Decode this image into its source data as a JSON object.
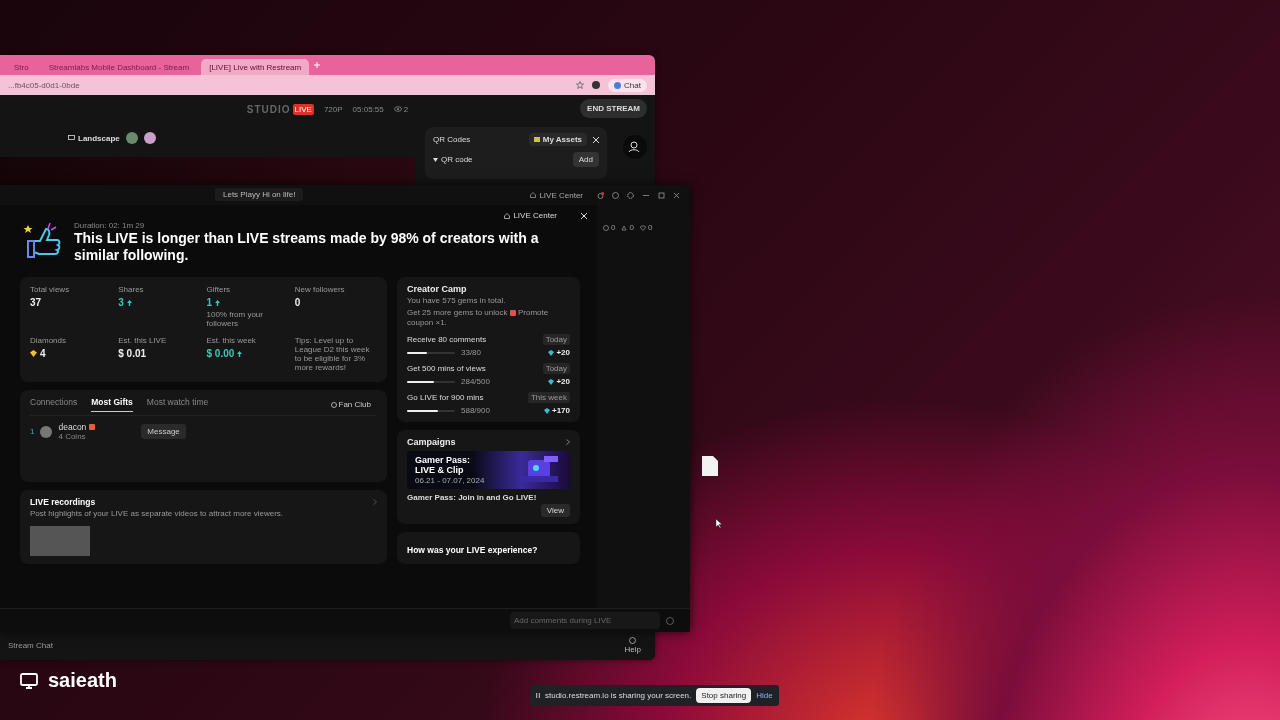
{
  "browser": {
    "tabs": [
      {
        "label": "Stro",
        "selected": false
      },
      {
        "label": "Streamlabs Mobile Dashboard - Stream",
        "selected": false
      },
      {
        "label": "[LIVE] Live with Restream",
        "selected": true
      }
    ],
    "address": "...fb4c05-d0d1-0bde",
    "chat_button": "Chat",
    "studio": {
      "logo": "STUDIO",
      "badge": "LIVE",
      "quality": "720P",
      "timer": "05:05:55",
      "viewers": "2",
      "end_button": "END STREAM"
    },
    "layout_button": "Landscape",
    "qr_panel": {
      "title": "QR Codes",
      "account": "My Assets",
      "section": "QR code",
      "add_button": "Add"
    },
    "chat_tab": "Stream Chat",
    "help": "Help"
  },
  "app": {
    "title": "Lets Playy Hi on life!",
    "live_center": "LIVE Center",
    "comment_placeholder": "Add comments during LIVE",
    "side_counts": [
      "0",
      "0",
      "0"
    ]
  },
  "dialog": {
    "live_center": "LIVE Center",
    "duration": "Duration: 02: 1m 29",
    "headline": "This LIVE is longer than LIVE streams made by 98% of creators with a similar following.",
    "stats": [
      {
        "label": "Total views",
        "value": "37",
        "kind": "count",
        "trend": false
      },
      {
        "label": "Shares",
        "value": "3",
        "kind": "count",
        "trend": true
      },
      {
        "label": "Gifters",
        "value": "1",
        "kind": "count",
        "trend": true,
        "note": "100% from your followers"
      },
      {
        "label": "New followers",
        "value": "0",
        "kind": "count",
        "trend": false
      },
      {
        "label": "Diamonds",
        "value": "4",
        "kind": "diamonds",
        "trend": false
      },
      {
        "label": "Est. this LIVE",
        "value": "$ 0.01",
        "kind": "money",
        "trend": false
      },
      {
        "label": "Est. this week",
        "value": "$ 0.00",
        "kind": "money",
        "trend": true
      }
    ],
    "tip": "Tips: Level up to League D2 this week to be eligible for 3% more rewards!",
    "tabs": [
      {
        "label": "Connections",
        "selected": false
      },
      {
        "label": "Most Gifts",
        "selected": true
      },
      {
        "label": "Most watch time",
        "selected": false
      }
    ],
    "fan_club": "Fan Club",
    "gifters": [
      {
        "rank": "1",
        "name": "deacon",
        "detail": "4 Coins",
        "action": "Message"
      }
    ],
    "recordings": {
      "title": "LIVE recordings",
      "description": "Post highlights of your LIVE as separate videos to attract more viewers."
    },
    "creator_camp": {
      "title": "Creator Camp",
      "gems": "You have 575 gems in total.",
      "unlock": "Get 25 more gems to unlock",
      "unlock_item": "Promote coupon ×1.",
      "tasks": [
        {
          "title": "Receive 80 comments",
          "period": "Today",
          "progress": "33/80",
          "level": 0.41,
          "reward": "+20"
        },
        {
          "title": "Get 500 mins of views",
          "period": "Today",
          "progress": "284/500",
          "level": 0.57,
          "reward": "+20"
        },
        {
          "title": "Go LIVE for 900 mins",
          "period": "This week",
          "progress": "588/900",
          "level": 0.65,
          "reward": "+170"
        }
      ]
    },
    "campaigns": {
      "title": "Campaigns",
      "banner_title": "Gamer Pass: LIVE & Clip",
      "banner_dates": "06.21 - 07.07, 2024",
      "caption": "Gamer Pass: Join in and Go LIVE!",
      "view_button": "View"
    },
    "feedback": "How was your LIVE experience?"
  },
  "desktop": {
    "user": "saieath"
  },
  "share_bar": {
    "message": "studio.restream.io is sharing your screen.",
    "stop_button": "Stop sharing",
    "hide_link": "Hide"
  }
}
